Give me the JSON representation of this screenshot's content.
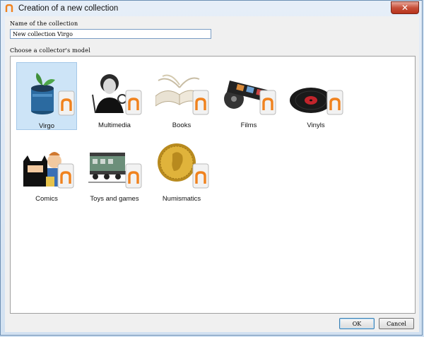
{
  "window": {
    "title": "Creation of a new collection",
    "close_glyph": "✕"
  },
  "name_field": {
    "label": "Name of the collection",
    "value": "New collection Virgo"
  },
  "models": {
    "label": "Choose a collector's model",
    "items": [
      {
        "label": "Virgo",
        "icon": "virgo-icon",
        "selected": true
      },
      {
        "label": "Multimedia",
        "icon": "multimedia-icon",
        "selected": false
      },
      {
        "label": "Books",
        "icon": "books-icon",
        "selected": false
      },
      {
        "label": "Films",
        "icon": "films-icon",
        "selected": false
      },
      {
        "label": "Vinyls",
        "icon": "vinyls-icon",
        "selected": false
      },
      {
        "label": "Comics",
        "icon": "comics-icon",
        "selected": false
      },
      {
        "label": "Toys and games",
        "icon": "toys-icon",
        "selected": false
      },
      {
        "label": "Numismatics",
        "icon": "numismatics-icon",
        "selected": false
      }
    ]
  },
  "buttons": {
    "ok": "OK",
    "cancel": "Cancel"
  },
  "colors": {
    "accent_orange": "#f0821e",
    "selection": "#cde4f7",
    "title_bar": "#d2e1f1"
  }
}
